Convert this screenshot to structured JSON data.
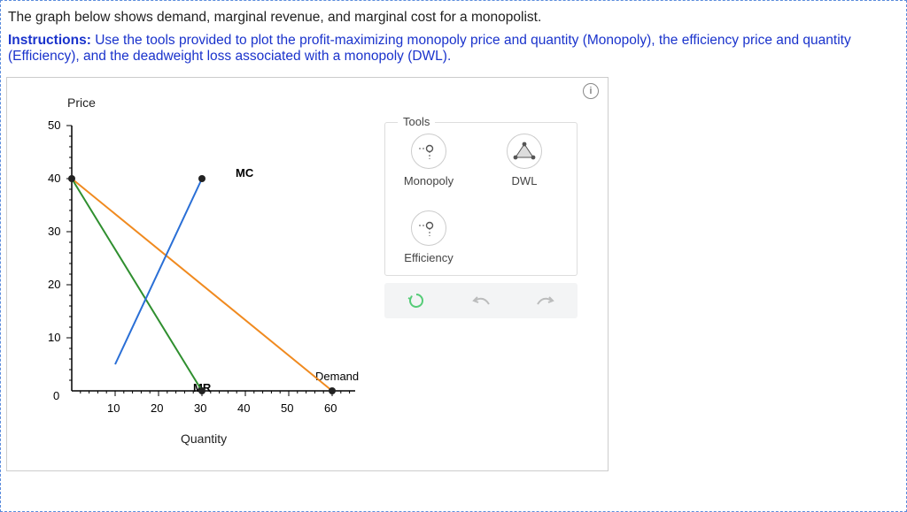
{
  "intro_text": "The graph below shows demand, marginal revenue, and marginal cost for a monopolist.",
  "instructions_label": "Instructions:",
  "instructions_text": "Use the tools provided to plot the profit-maximizing monopoly price and quantity (Monopoly), the efficiency price and quantity (Efficiency), and the deadweight loss associated with a monopoly (DWL).",
  "info_icon": "i",
  "axis": {
    "y_title": "Price",
    "x_title": "Quantity"
  },
  "y_ticks": [
    "0",
    "10",
    "20",
    "30",
    "40",
    "50"
  ],
  "x_ticks": [
    "10",
    "20",
    "30",
    "40",
    "50",
    "60"
  ],
  "curves": {
    "mc": "MC",
    "mr": "MR",
    "demand": "Demand"
  },
  "tools": {
    "legend": "Tools",
    "monopoly": "Monopoly",
    "dwl": "DWL",
    "efficiency": "Efficiency"
  },
  "controls": {
    "reset": "reset",
    "undo": "undo",
    "redo": "redo"
  },
  "chart_data": {
    "type": "line",
    "xlabel": "Quantity",
    "ylabel": "Price",
    "xlim": [
      0,
      65
    ],
    "ylim": [
      0,
      50
    ],
    "series": [
      {
        "name": "Demand",
        "color": "#f08a1f",
        "points": [
          [
            0,
            40
          ],
          [
            60,
            0
          ]
        ]
      },
      {
        "name": "MR",
        "color": "#2f8f2f",
        "points": [
          [
            0,
            40
          ],
          [
            30,
            0
          ]
        ]
      },
      {
        "name": "MC",
        "color": "#2a6fd6",
        "points": [
          [
            10,
            5
          ],
          [
            30,
            40
          ]
        ]
      }
    ],
    "x_ticks": [
      10,
      20,
      30,
      40,
      50,
      60
    ],
    "y_ticks": [
      0,
      10,
      20,
      30,
      40,
      50
    ],
    "annotations": [
      {
        "text": "MC",
        "x": 30,
        "y": 40
      },
      {
        "text": "MR",
        "x": 30,
        "y": 0
      },
      {
        "text": "Demand",
        "x": 60,
        "y": 0
      }
    ]
  }
}
